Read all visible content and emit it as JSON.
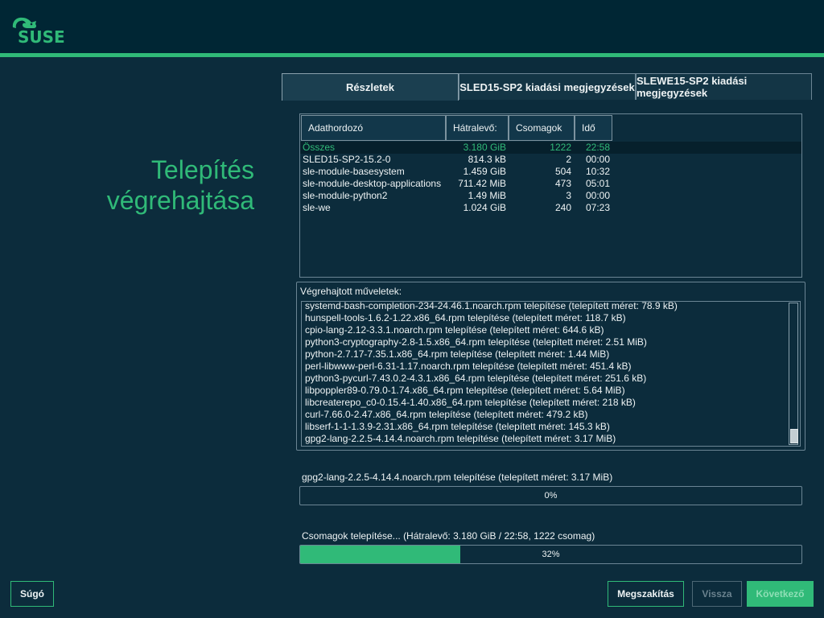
{
  "brand": {
    "logo_text": "SUSE",
    "accent": "#30ba78"
  },
  "page": {
    "title_line1": "Telepítés",
    "title_line2": "végrehajtása"
  },
  "tabs": [
    {
      "label": "Részletek",
      "active": true
    },
    {
      "label": "SLED15-SP2 kiadási megjegyzések",
      "active": false
    },
    {
      "label": "SLEWE15-SP2 kiadási megjegyzések",
      "active": false
    }
  ],
  "media_table": {
    "columns": [
      "Adathordozó",
      "Hátralevő:",
      "Csomagok",
      "Idő"
    ],
    "rows": [
      [
        "Összes",
        "3.180 GiB",
        "1222",
        "22:58"
      ],
      [
        "SLED15-SP2-15.2-0",
        "814.3 kB",
        "2",
        "00:00"
      ],
      [
        "sle-module-basesystem",
        "1.459 GiB",
        "504",
        "10:32"
      ],
      [
        "sle-module-desktop-applications",
        "711.42 MiB",
        "473",
        "05:01"
      ],
      [
        "sle-module-python2",
        "1.49 MiB",
        "3",
        "00:00"
      ],
      [
        "sle-we",
        "1.024 GiB",
        "240",
        "07:23"
      ]
    ]
  },
  "operations": {
    "label": "Végrehajtott műveletek:",
    "lines": [
      "systemd-bash-completion-234-24.46.1.noarch.rpm telepítése (telepített méret: 78.9 kB)",
      "hunspell-tools-1.6.2-1.22.x86_64.rpm telepítése (telepített méret: 118.7 kB)",
      "cpio-lang-2.12-3.3.1.noarch.rpm telepítése (telepített méret: 644.6 kB)",
      "python3-cryptography-2.8-1.5.x86_64.rpm telepítése (telepített méret: 2.51 MiB)",
      "python-2.7.17-7.35.1.x86_64.rpm telepítése (telepített méret: 1.44 MiB)",
      "perl-libwww-perl-6.31-1.17.noarch.rpm telepítése (telepített méret: 451.4 kB)",
      "python3-pycurl-7.43.0.2-4.3.1.x86_64.rpm telepítése (telepített méret: 251.6 kB)",
      "libpoppler89-0.79.0-1.74.x86_64.rpm telepítése (telepített méret: 5.64 MiB)",
      "libcreaterepo_c0-0.15.4-1.40.x86_64.rpm telepítése (telepített méret: 218 kB)",
      "curl-7.66.0-2.47.x86_64.rpm telepítése (telepített méret: 479.2 kB)",
      "libserf-1-1-1.3.9-2.31.x86_64.rpm telepítése (telepített méret: 145.3 kB)",
      "gpg2-lang-2.2.5-4.14.4.noarch.rpm telepítése (telepített méret: 3.17 MiB)"
    ]
  },
  "current_package": {
    "label": "gpg2-lang-2.2.5-4.14.4.noarch.rpm telepítése (telepített méret: 3.17 MiB)",
    "progress_text": "0%",
    "progress": 0
  },
  "overall": {
    "label": "Csomagok telepítése... (Hátralevő: 3.180 GiB / 22:58, 1222 csomag)",
    "progress_text": "32%",
    "progress": 0.32
  },
  "buttons": {
    "help": "Súgó",
    "abort": "Megszakítás",
    "back": "Vissza",
    "next": "Következő"
  }
}
